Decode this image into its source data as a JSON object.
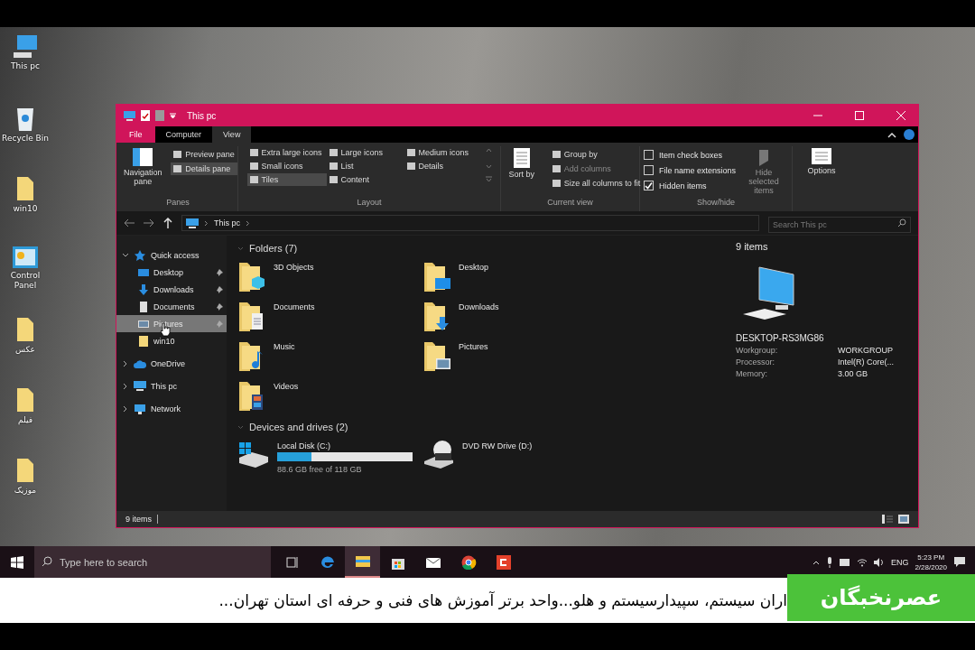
{
  "desktop_icons": [
    {
      "label": "This pc",
      "kind": "computer"
    },
    {
      "label": "Recycle Bin",
      "kind": "bin"
    },
    {
      "label": "win10",
      "kind": "folder"
    },
    {
      "label": "Control Panel",
      "kind": "panel"
    },
    {
      "label": "عکس",
      "kind": "folder"
    },
    {
      "label": "فیلم",
      "kind": "folder"
    },
    {
      "label": "موزیک",
      "kind": "folder"
    }
  ],
  "window": {
    "title": "This pc",
    "ribbon_tabs": [
      {
        "label": "File",
        "selected": false,
        "kind": "file"
      },
      {
        "label": "Computer",
        "selected": false,
        "kind": "tab"
      },
      {
        "label": "View",
        "selected": true,
        "kind": "tab"
      }
    ],
    "panes": {
      "navigation_pane": "Navigation pane",
      "options": [
        {
          "label": "Preview pane",
          "selected": false
        },
        {
          "label": "Details pane",
          "selected": true
        }
      ],
      "label": "Panes"
    },
    "layout": {
      "options": [
        {
          "label": "Extra large icons",
          "selected": false
        },
        {
          "label": "Large icons",
          "selected": false
        },
        {
          "label": "Medium icons",
          "selected": false
        },
        {
          "label": "Small icons",
          "selected": false
        },
        {
          "label": "List",
          "selected": false
        },
        {
          "label": "Details",
          "selected": false
        },
        {
          "label": "Tiles",
          "selected": true
        },
        {
          "label": "Content",
          "selected": false
        }
      ],
      "label": "Layout"
    },
    "current_view": {
      "sort_by": "Sort by",
      "items": [
        {
          "label": "Group by",
          "disabled": false
        },
        {
          "label": "Add columns",
          "disabled": true
        },
        {
          "label": "Size all columns to fit",
          "disabled": false
        }
      ],
      "label": "Current view"
    },
    "show_hide": {
      "checkboxes": [
        {
          "label": "Item check boxes",
          "checked": false
        },
        {
          "label": "File name extensions",
          "checked": false
        },
        {
          "label": "Hidden items",
          "checked": true
        }
      ],
      "hide_selected": "Hide selected items",
      "label": "Show/hide"
    },
    "options": "Options",
    "address": {
      "path": "This pc",
      "search_placeholder": "Search This pc"
    },
    "nav_pane": [
      {
        "label": "Quick access",
        "kind": "star",
        "expanded": true,
        "selected": false,
        "children": [
          {
            "label": "Desktop",
            "kind": "desktop",
            "pinned": true,
            "selected": false
          },
          {
            "label": "Downloads",
            "kind": "downloads",
            "pinned": true,
            "selected": false
          },
          {
            "label": "Documents",
            "kind": "documents",
            "pinned": true,
            "selected": false
          },
          {
            "label": "Pictures",
            "kind": "pictures",
            "pinned": true,
            "selected": true
          },
          {
            "label": "win10",
            "kind": "folder",
            "pinned": false,
            "selected": false
          }
        ]
      },
      {
        "label": "OneDrive",
        "kind": "cloud",
        "expanded": false,
        "selected": false
      },
      {
        "label": "This pc",
        "kind": "computer",
        "expanded": false,
        "selected": false
      },
      {
        "label": "Network",
        "kind": "network",
        "expanded": false,
        "selected": false
      }
    ],
    "folders": {
      "heading": "Folders (7)",
      "items": [
        {
          "name": "3D Objects",
          "kind": "objects"
        },
        {
          "name": "Desktop",
          "kind": "desktop"
        },
        {
          "name": "Documents",
          "kind": "documents"
        },
        {
          "name": "Downloads",
          "kind": "downloads"
        },
        {
          "name": "Music",
          "kind": "music"
        },
        {
          "name": "Pictures",
          "kind": "pictures"
        },
        {
          "name": "Videos",
          "kind": "videos"
        }
      ]
    },
    "drives": {
      "heading": "Devices and drives (2)",
      "items": [
        {
          "name": "Local Disk (C:)",
          "kind": "disk",
          "level": 0.25,
          "free": "88.6 GB free of 118 GB"
        },
        {
          "name": "DVD RW Drive (D:)",
          "kind": "dvd"
        }
      ]
    },
    "details": {
      "count": "9 items",
      "computer_name": "DESKTOP-RS3MG86",
      "properties": [
        {
          "label": "Workgroup:",
          "value": "WORKGROUP"
        },
        {
          "label": "Processor:",
          "value": "Intel(R) Core(..."
        },
        {
          "label": "Memory:",
          "value": "3.00 GB"
        }
      ]
    },
    "status_bar": "9 items"
  },
  "taskbar": {
    "search_placeholder": "Type here to search",
    "apps": [
      {
        "kind": "taskview",
        "selected": false
      },
      {
        "kind": "edge",
        "selected": false
      },
      {
        "kind": "explorer",
        "selected": true
      },
      {
        "kind": "store",
        "selected": false
      },
      {
        "kind": "mail",
        "selected": false
      },
      {
        "kind": "chrome",
        "selected": false
      },
      {
        "kind": "red",
        "selected": false
      }
    ],
    "language": "ENG",
    "time": "5:23 PM",
    "date": "2/28/2020"
  },
  "ticker": {
    "text": "اران سیستم، سپیدارسیستم و هلو...واحد برتر آموزش های فنی و حرفه ای استان تهران...",
    "logo": "عصرنخبگان"
  }
}
